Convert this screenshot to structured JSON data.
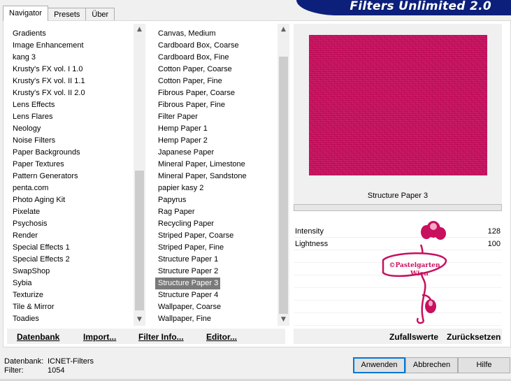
{
  "tabs": [
    {
      "label": "Navigator",
      "active": true
    },
    {
      "label": "Presets",
      "active": false
    },
    {
      "label": "Über",
      "active": false
    }
  ],
  "banner": {
    "title": "Filters Unlimited 2.0"
  },
  "categories": {
    "items": [
      "Gradients",
      "Image Enhancement",
      "kang 3",
      "Krusty's FX vol. I 1.0",
      "Krusty's FX vol. II 1.1",
      "Krusty's FX vol. II 2.0",
      "Lens Effects",
      "Lens Flares",
      "Neology",
      "Noise Filters",
      "Paper Backgrounds",
      "Paper Textures",
      "Pattern Generators",
      "penta.com",
      "Photo Aging Kit",
      "Pixelate",
      "Psychosis",
      "Render",
      "Special Effects 1",
      "Special Effects 2",
      "SwapShop",
      "Sybia",
      "Texturize",
      "Tile & Mirror",
      "Toadies"
    ],
    "selected_index": 11,
    "scroll_position": 0.72
  },
  "filters": {
    "items": [
      "Canvas, Medium",
      "Cardboard Box, Coarse",
      "Cardboard Box, Fine",
      "Cotton Paper, Coarse",
      "Cotton Paper, Fine",
      "Fibrous Paper, Coarse",
      "Fibrous Paper, Fine",
      "Filter Paper",
      "Hemp Paper 1",
      "Hemp Paper 2",
      "Japanese Paper",
      "Mineral Paper, Limestone",
      "Mineral Paper, Sandstone",
      "papier kasy 2",
      "Papyrus",
      "Rag Paper",
      "Recycling Paper",
      "Striped Paper, Coarse",
      "Striped Paper, Fine",
      "Structure Paper 1",
      "Structure Paper 2",
      "Structure Paper 3",
      "Structure Paper 4",
      "Wallpaper, Coarse",
      "Wallpaper, Fine"
    ],
    "selected_index": 21,
    "scroll_position": 1.0
  },
  "preview": {
    "filter_name": "Structure Paper 3",
    "fill_color": "#c8105f",
    "progress": 0
  },
  "sliders": [
    {
      "label": "Intensity",
      "value": "128"
    },
    {
      "label": "Lightness",
      "value": "100"
    }
  ],
  "watermark": {
    "line1": "©Pastelgarten",
    "line2": "Wien"
  },
  "left_buttons": {
    "database": "Datenbank",
    "import": "Import...",
    "filter_info": "Filter Info...",
    "editor": "Editor..."
  },
  "right_buttons": {
    "random": "Zufallswerte",
    "reset": "Zurücksetzen"
  },
  "status": {
    "database_label": "Datenbank:",
    "database_value": "ICNET-Filters",
    "filter_label": "Filter:",
    "filter_value": "1054"
  },
  "dialog_buttons": {
    "apply": "Anwenden",
    "cancel": "Abbrechen",
    "help": "Hilfe"
  },
  "colors": {
    "banner": "#0c1f7a",
    "selection": "#7a7a7a",
    "preview": "#c8105f"
  }
}
